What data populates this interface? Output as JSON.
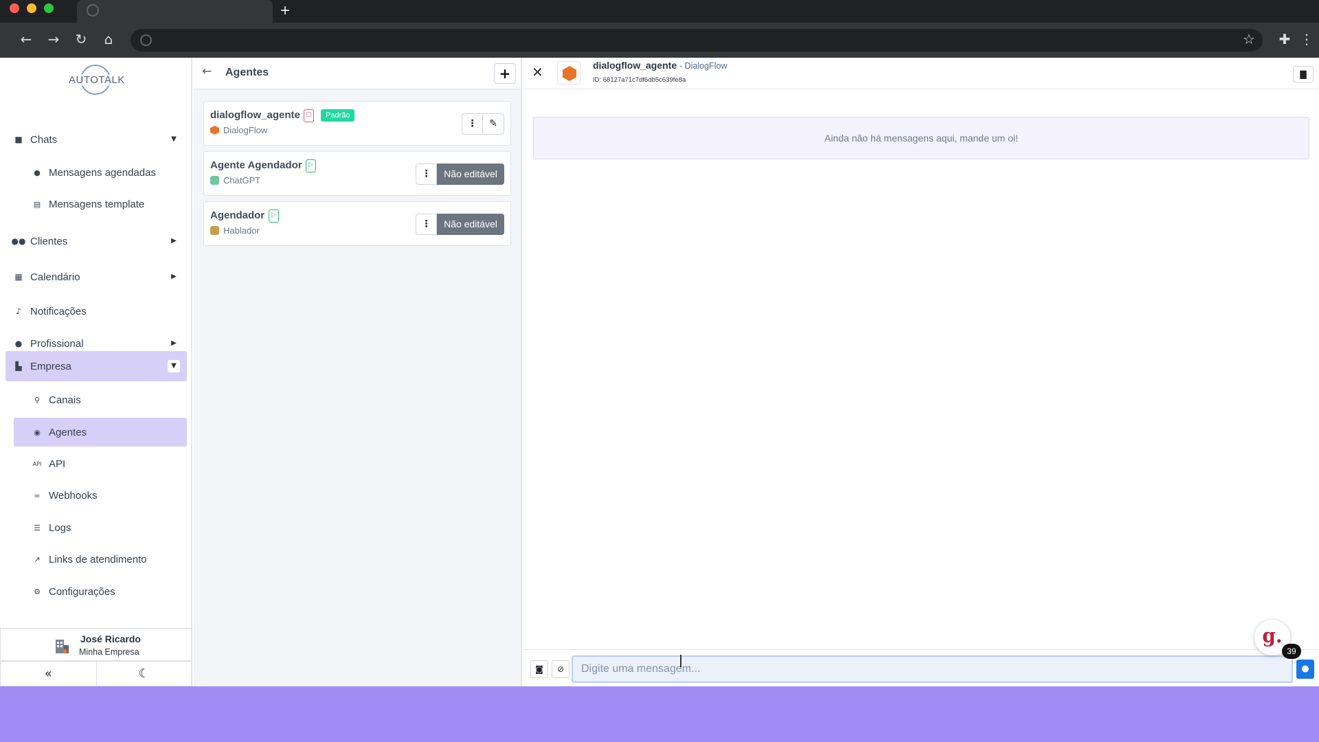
{
  "browser": {
    "colors": {
      "close": "#ff5f57",
      "minimize": "#febc2e",
      "maximize": "#28c840"
    }
  },
  "sidebar": {
    "logo_text": "AUTOTALK",
    "items": [
      {
        "label": "Chats",
        "icon": "chat-icon"
      },
      {
        "label": "Mensagens agendadas",
        "icon": "clock-icon"
      },
      {
        "label": "Mensagens template",
        "icon": "template-icon"
      },
      {
        "label": "Clientes",
        "icon": "users-icon"
      },
      {
        "label": "Calendário",
        "icon": "calendar-icon"
      },
      {
        "label": "Notificações",
        "icon": "bell-icon"
      },
      {
        "label": "Profissional",
        "icon": "user-gear-icon"
      },
      {
        "label": "Empresa",
        "icon": "building-icon"
      },
      {
        "label": "Canais",
        "icon": "plug-icon"
      },
      {
        "label": "Agentes",
        "icon": "robot-icon"
      },
      {
        "label": "API",
        "icon": "api-icon"
      },
      {
        "label": "Webhooks",
        "icon": "webhook-icon"
      },
      {
        "label": "Logs",
        "icon": "list-icon"
      },
      {
        "label": "Links de atendimento",
        "icon": "external-link-icon"
      },
      {
        "label": "Configurações",
        "icon": "gear-icon"
      }
    ],
    "user": {
      "name": "José Ricardo",
      "company": "Minha Empresa"
    },
    "accent": "#d6cff8"
  },
  "agents": {
    "title": "Agentes",
    "list": [
      {
        "name": "dialogflow_agente",
        "platform": "DialogFlow",
        "badge": "Padrão"
      },
      {
        "name": "Agente Agendador",
        "platform": "ChatGPT",
        "action": "Não editável"
      },
      {
        "name": "Agendador",
        "platform": "Hablador",
        "action": "Não editável"
      }
    ]
  },
  "chat": {
    "agent_name": "dialogflow_agente",
    "platform_suffix": "- DialogFlow",
    "id_text": "ID: 68127a71c7df6db5c639fe8a",
    "empty_message": "Ainda não há mensagens aqui, mande um oi!",
    "input_placeholder": "Digite uma mensagem...",
    "input_value": ""
  },
  "grammarly": {
    "letter": "g.",
    "count": "39"
  }
}
